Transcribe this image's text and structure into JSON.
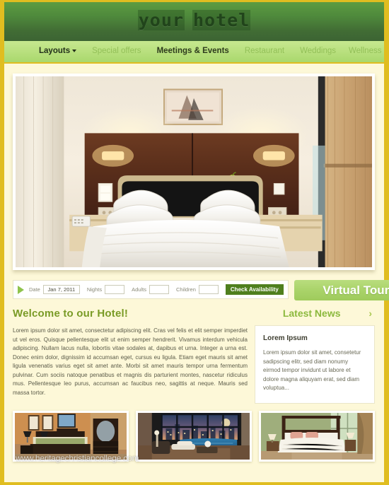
{
  "site": {
    "logo_text_part1": "your",
    "logo_text_part2": "hotel",
    "watermark": "www.heritagechristiancollege.com"
  },
  "nav": {
    "items": [
      {
        "label": "Layouts",
        "state": "dark",
        "has_caret": true
      },
      {
        "label": "Special offers",
        "state": "muted",
        "has_caret": false
      },
      {
        "label": "Meetings & Events",
        "state": "active",
        "has_caret": false
      },
      {
        "label": "Restaurant",
        "state": "muted",
        "has_caret": false
      },
      {
        "label": "Weddings",
        "state": "muted",
        "has_caret": false
      },
      {
        "label": "Wellness",
        "state": "muted",
        "has_caret": false
      }
    ]
  },
  "booking": {
    "date_label": "Date",
    "date_value": "Jan 7, 2011",
    "nights_label": "Nights",
    "nights_value": "",
    "nights_placeholder": "",
    "adults_label": "Adults",
    "adults_value": "",
    "children_label": "Children",
    "children_value": "",
    "check_button": "Check Availability",
    "virtual_tour": "Virtual Tour"
  },
  "welcome": {
    "title": "Welcome to our Hotel!",
    "body": "Lorem ipsum dolor sit amet, consectetur adipiscing elit. Cras vel felis et elit semper imperdiet ut vel eros. Quisque pellentesque elit ut enim semper hendrerit. Vivamus interdum vehicula adipiscing. Nullam lacus nulla, lobortis vitae sodales at, dapibus et urna. Integer a urna est. Donec enim dolor, dignissim id accumsan eget, cursus eu ligula. Etiam eget mauris sit amet ligula venenatis varius eget sit amet ante. Morbi sit amet mauris tempor urna fermentum pulvinar. Cum sociis natoque penatibus et magnis dis parturient montes, nascetur ridiculus mus. Pellentesque leo purus, accumsan ac faucibus neo, sagittis at neque. Mauris sed massa tortor."
  },
  "news": {
    "title": "Latest News",
    "arrow": "›",
    "item_title": "Lorem Ipsum",
    "item_body": "Lorem ipsum dolor sit amet, consetetur sadipscing elitr, sed diam nonumy eirmod tempor invidunt ut labore et dolore magna aliquyam erat, sed diam voluptua..."
  },
  "colors": {
    "border_gold": "#e0bd20",
    "header_green_top": "#5d9c41",
    "header_green_bottom": "#3c6433",
    "nav_green": "#b9e07f",
    "page_cream": "#fdf8d8",
    "accent_olive": "#7a9b26",
    "button_dark_green": "#4f7f1e"
  }
}
